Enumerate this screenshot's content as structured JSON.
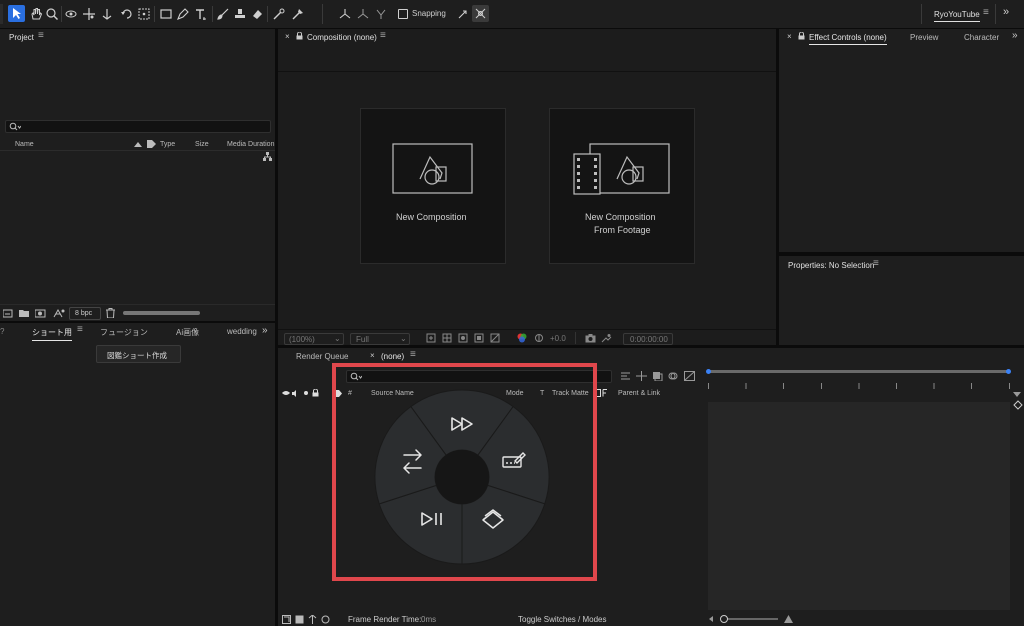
{
  "toolbar": {
    "snapping_label": "Snapping",
    "workspace_label": "RyoYouTube",
    "tools": [
      "selection-tool",
      "hand-tool",
      "zoom-tool",
      "orbit-tool",
      "pan-tool",
      "dolly-tool",
      "rotation-tool",
      "pan-behind-tool",
      "rectangle-tool",
      "pen-tool",
      "type-tool",
      "brush-tool",
      "clone-stamp-tool",
      "eraser-tool",
      "roto-brush-tool",
      "puppet-tool"
    ]
  },
  "project_panel": {
    "title": "Project",
    "columns": [
      "Name",
      "Type",
      "Size",
      "Media Duration"
    ],
    "bpc_label": "8 bpc"
  },
  "custom_panel": {
    "tabs": [
      "ショート用",
      "フュージョン",
      "Ai画像",
      "wedding"
    ],
    "action_button": "図鑑ショート作成"
  },
  "composition_panel": {
    "tab_label": "Composition (none)",
    "new_comp_label": "New Composition",
    "new_comp_footage_line1": "New Composition",
    "new_comp_footage_line2": "From Footage",
    "zoom_value": "(100%)",
    "resolution_value": "Full",
    "exposure_value": "+0.0",
    "timecode_value": "0:00:00:00"
  },
  "effect_panel": {
    "tabs": [
      "Effect Controls (none)",
      "Preview",
      "Character"
    ]
  },
  "properties_panel": {
    "title": "Properties: No Selection"
  },
  "timeline_panel": {
    "tabs": [
      "Render Queue",
      "(none)"
    ],
    "columns": [
      "#",
      "Source Name",
      "Mode",
      "T",
      "Track Matte",
      "Parent & Link"
    ],
    "frame_render_label": "Frame Render Time:",
    "frame_render_value": "0ms",
    "toggle_label": "Toggle Switches / Modes"
  },
  "radial_menu": {
    "segments": [
      "fast-forward",
      "keyframe-edit",
      "layers",
      "play-pause",
      "swap"
    ],
    "highlight_color": "#e0474c"
  }
}
